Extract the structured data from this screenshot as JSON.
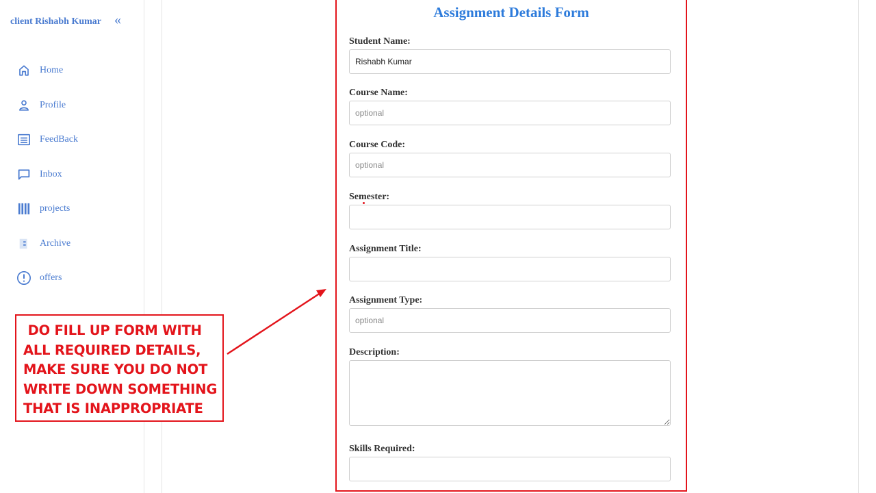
{
  "sidebar": {
    "client_name": "client Rishabh Kumar",
    "collapse_glyph": "«",
    "items": [
      {
        "label": "Home",
        "icon": "home-icon"
      },
      {
        "label": "Profile",
        "icon": "user-icon"
      },
      {
        "label": "FeedBack",
        "icon": "list-icon"
      },
      {
        "label": "Inbox",
        "icon": "message-icon"
      },
      {
        "label": "projects",
        "icon": "bars-icon"
      },
      {
        "label": "Archive",
        "icon": "archive-icon"
      },
      {
        "label": "offers",
        "icon": "alert-circle-icon"
      }
    ]
  },
  "form": {
    "title": "Assignment Details Form",
    "fields": {
      "student_name": {
        "label": "Student Name:",
        "value": "Rishabh Kumar",
        "placeholder": ""
      },
      "course_name": {
        "label": "Course Name:",
        "value": "",
        "placeholder": "optional"
      },
      "course_code": {
        "label": "Course Code:",
        "value": "",
        "placeholder": "optional"
      },
      "semester": {
        "label": "Semester:",
        "value": "",
        "placeholder": ""
      },
      "assignment_title": {
        "label": "Assignment Title:",
        "value": "",
        "placeholder": ""
      },
      "assignment_type": {
        "label": "Assignment Type:",
        "value": "",
        "placeholder": "optional"
      },
      "description": {
        "label": "Description:",
        "value": "",
        "placeholder": ""
      },
      "skills_required": {
        "label": "Skills Required:",
        "value": "",
        "placeholder": ""
      }
    }
  },
  "annotation": {
    "text": " DO FILL UP FORM WITH\nALL REQUIRED DETAILS,\nMAKE SURE YOU DO NOT\nWRITE DOWN SOMETHING\nTHAT IS INAPPROPRIATE"
  },
  "colors": {
    "accent": "#4a7bd0",
    "title": "#2d7bdb",
    "annotation": "#e3141b"
  }
}
